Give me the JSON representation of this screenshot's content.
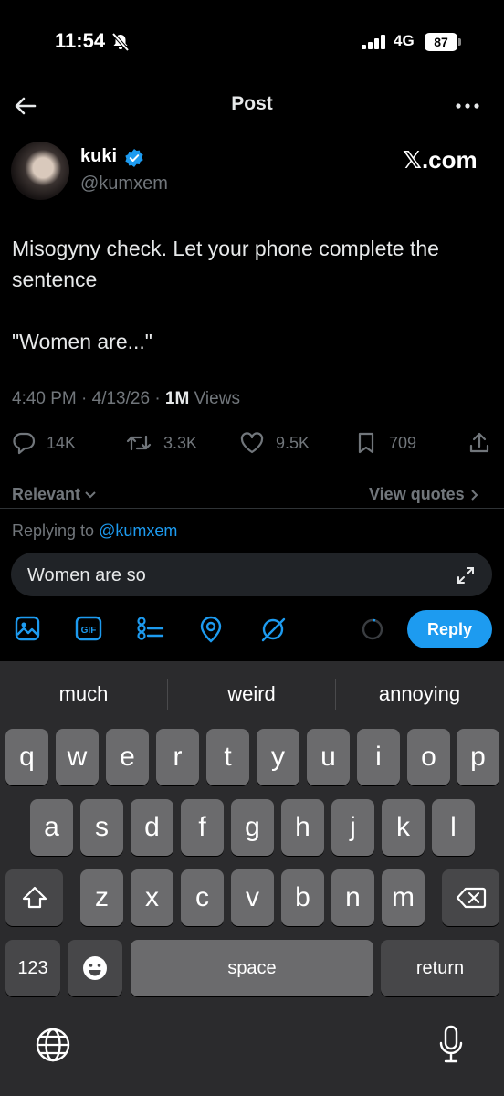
{
  "status_bar": {
    "time": "11:54",
    "network": "4G",
    "battery": "87"
  },
  "header": {
    "title": "Post"
  },
  "author": {
    "name": "kuki",
    "handle": "@kumxem",
    "source": "𝕏.com"
  },
  "tweet": {
    "text": "Misogyny check. Let your phone complete the sentence\n\n\"Women are...\"",
    "timestamp": "4:40 PM · 4/13/26 · ",
    "views_count": "1M",
    "views_label": " Views"
  },
  "actions": {
    "replies": "14K",
    "reposts": "3.3K",
    "likes": "9.5K",
    "bookmarks": "709"
  },
  "filter": {
    "label": "Relevant",
    "view_quotes": "View quotes"
  },
  "reply": {
    "replying_to_label": "Replying to ",
    "replying_to_handle": "@kumxem",
    "input_value": "Women are so",
    "button_label": "Reply"
  },
  "keyboard": {
    "suggestions": [
      "much",
      "weird",
      "annoying"
    ],
    "row1": [
      "q",
      "w",
      "e",
      "r",
      "t",
      "y",
      "u",
      "i",
      "o",
      "p"
    ],
    "row2": [
      "a",
      "s",
      "d",
      "f",
      "g",
      "h",
      "j",
      "k",
      "l"
    ],
    "row3": [
      "z",
      "x",
      "c",
      "v",
      "b",
      "n",
      "m"
    ],
    "numbers_key": "123",
    "space_key": "space",
    "return_key": "return"
  },
  "colors": {
    "accent": "#1d9bf0",
    "background": "#000000",
    "keyboard_bg": "#2b2b2d"
  }
}
